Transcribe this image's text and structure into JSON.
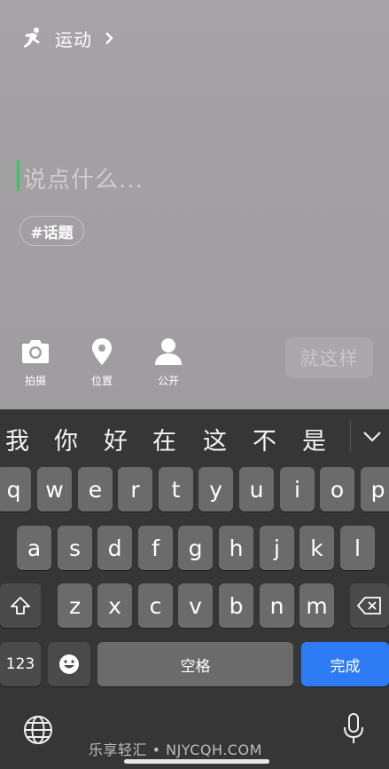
{
  "header": {
    "sport_label": "运动"
  },
  "composer": {
    "placeholder": "说点什么..."
  },
  "topic": {
    "label": "#话题"
  },
  "tools": [
    {
      "label": "拍摄",
      "icon": "camera-icon"
    },
    {
      "label": "位置",
      "icon": "location-pin-icon"
    },
    {
      "label": "公开",
      "icon": "person-icon"
    }
  ],
  "submit": {
    "label": "就这样"
  },
  "keyboard": {
    "candidates": [
      "我",
      "你",
      "好",
      "在",
      "这",
      "不",
      "是"
    ],
    "row1": [
      "q",
      "w",
      "e",
      "r",
      "t",
      "y",
      "u",
      "i",
      "o",
      "p"
    ],
    "row2": [
      "a",
      "s",
      "d",
      "f",
      "g",
      "h",
      "j",
      "k",
      "l"
    ],
    "row3": [
      "z",
      "x",
      "c",
      "v",
      "b",
      "n",
      "m"
    ],
    "numbers_label": "123",
    "space_label": "空格",
    "done_label": "完成"
  },
  "watermark": "乐享轻汇 • NJYCQH.COM",
  "colors": {
    "cursor": "#32c860",
    "done_key": "#2d7cf6"
  }
}
